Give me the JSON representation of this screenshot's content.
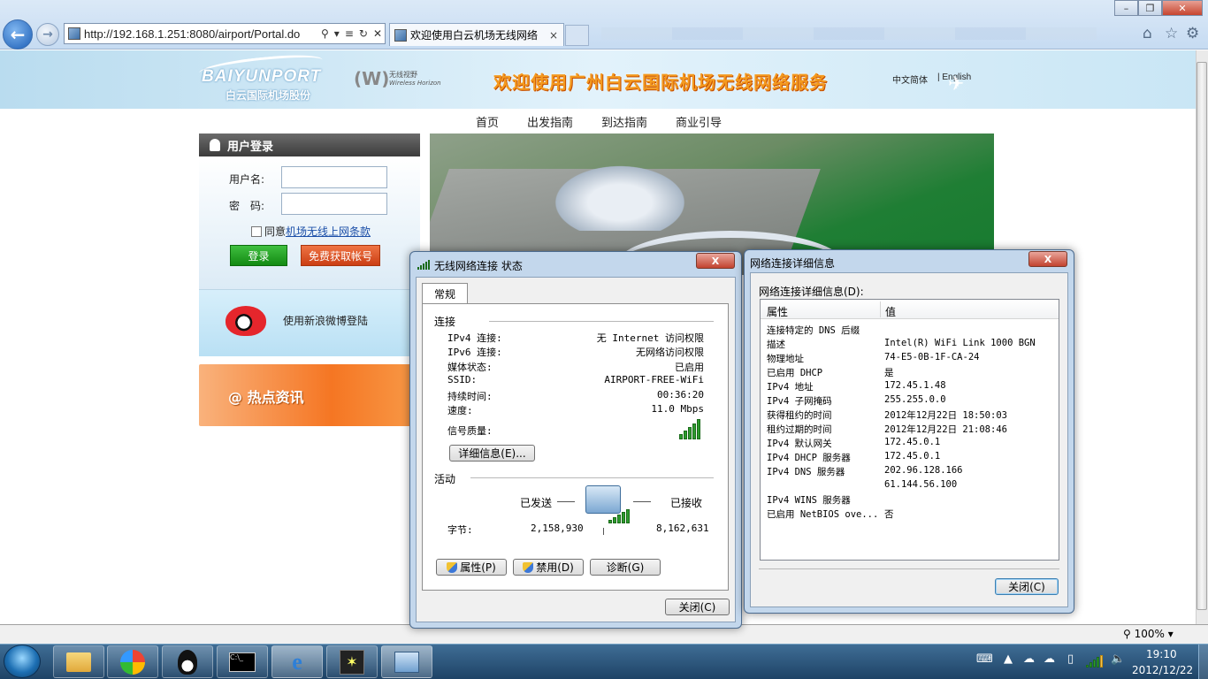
{
  "browser": {
    "url": "http://192.168.1.251:8080/airport/Portal.do",
    "tab_title": "欢迎使用白云机场无线网络",
    "tab_close": "×",
    "zoom": "100%"
  },
  "site": {
    "logo_en": "BAIYUNPORT",
    "logo_cn": "白云国际机场股份",
    "partner_cn": "无线视野",
    "partner_en": "Wireless Horizon",
    "welcome": "欢迎使用广州白云国际机场无线网络服务",
    "lang_cn": "中文简体",
    "lang_en": "| English",
    "menu": [
      "首页",
      "出发指南",
      "到达指南",
      "商业引导"
    ],
    "login": {
      "title": "用户登录",
      "username_label": "用户名:",
      "password_label": "密　码:",
      "agree_text": "同意",
      "terms_link": "机场无线上网条款",
      "login_button": "登录",
      "free_account_button": "免费获取帐号"
    },
    "weibo_login": "使用新浪微博登陆",
    "news_title": "热点资讯"
  },
  "status_dialog": {
    "title": "无线网络连接 状态",
    "close": "X",
    "tab": "常规",
    "group_connection": "连接",
    "rows": [
      {
        "label": "IPv4 连接:",
        "value": "无 Internet 访问权限"
      },
      {
        "label": "IPv6 连接:",
        "value": "无网络访问权限"
      },
      {
        "label": "媒体状态:",
        "value": "已启用"
      },
      {
        "label": "SSID:",
        "value": "AIRPORT-FREE-WiFi"
      },
      {
        "label": "持续时间:",
        "value": "00:36:20"
      },
      {
        "label": "速度:",
        "value": "11.0 Mbps"
      }
    ],
    "signal_label": "信号质量:",
    "details_button": "详细信息(E)...",
    "group_activity": "活动",
    "sent_label": "已发送",
    "received_label": "已接收",
    "bytes_label": "字节:",
    "bytes_sent": "2,158,930",
    "bytes_received": "8,162,631",
    "properties_button": "属性(P)",
    "disable_button": "禁用(D)",
    "diagnose_button": "诊断(G)",
    "close_button": "关闭(C)"
  },
  "details_dialog": {
    "title": "网络连接详细信息",
    "close": "X",
    "caption": "网络连接详细信息(D):",
    "col_property": "属性",
    "col_value": "值",
    "rows": [
      {
        "property": "连接特定的 DNS 后缀",
        "value": ""
      },
      {
        "property": "描述",
        "value": "Intel(R) WiFi Link 1000 BGN"
      },
      {
        "property": "物理地址",
        "value": "74-E5-0B-1F-CA-24"
      },
      {
        "property": "已启用 DHCP",
        "value": "是"
      },
      {
        "property": "IPv4 地址",
        "value": "172.45.1.48"
      },
      {
        "property": "IPv4 子网掩码",
        "value": "255.255.0.0"
      },
      {
        "property": "获得租约的时间",
        "value": "2012年12月22日 18:50:03"
      },
      {
        "property": "租约过期的时间",
        "value": "2012年12月22日 21:08:46"
      },
      {
        "property": "IPv4 默认网关",
        "value": "172.45.0.1"
      },
      {
        "property": "IPv4 DHCP 服务器",
        "value": "172.45.0.1"
      },
      {
        "property": "IPv4 DNS 服务器",
        "value": "202.96.128.166"
      },
      {
        "property": "",
        "value": "61.144.56.100"
      },
      {
        "property": "IPv4 WINS 服务器",
        "value": ""
      },
      {
        "property": "已启用 NetBIOS ove...",
        "value": "否"
      }
    ],
    "close_button": "关闭(C)"
  },
  "taskbar": {
    "time": "19:10",
    "date": "2012/12/22"
  }
}
